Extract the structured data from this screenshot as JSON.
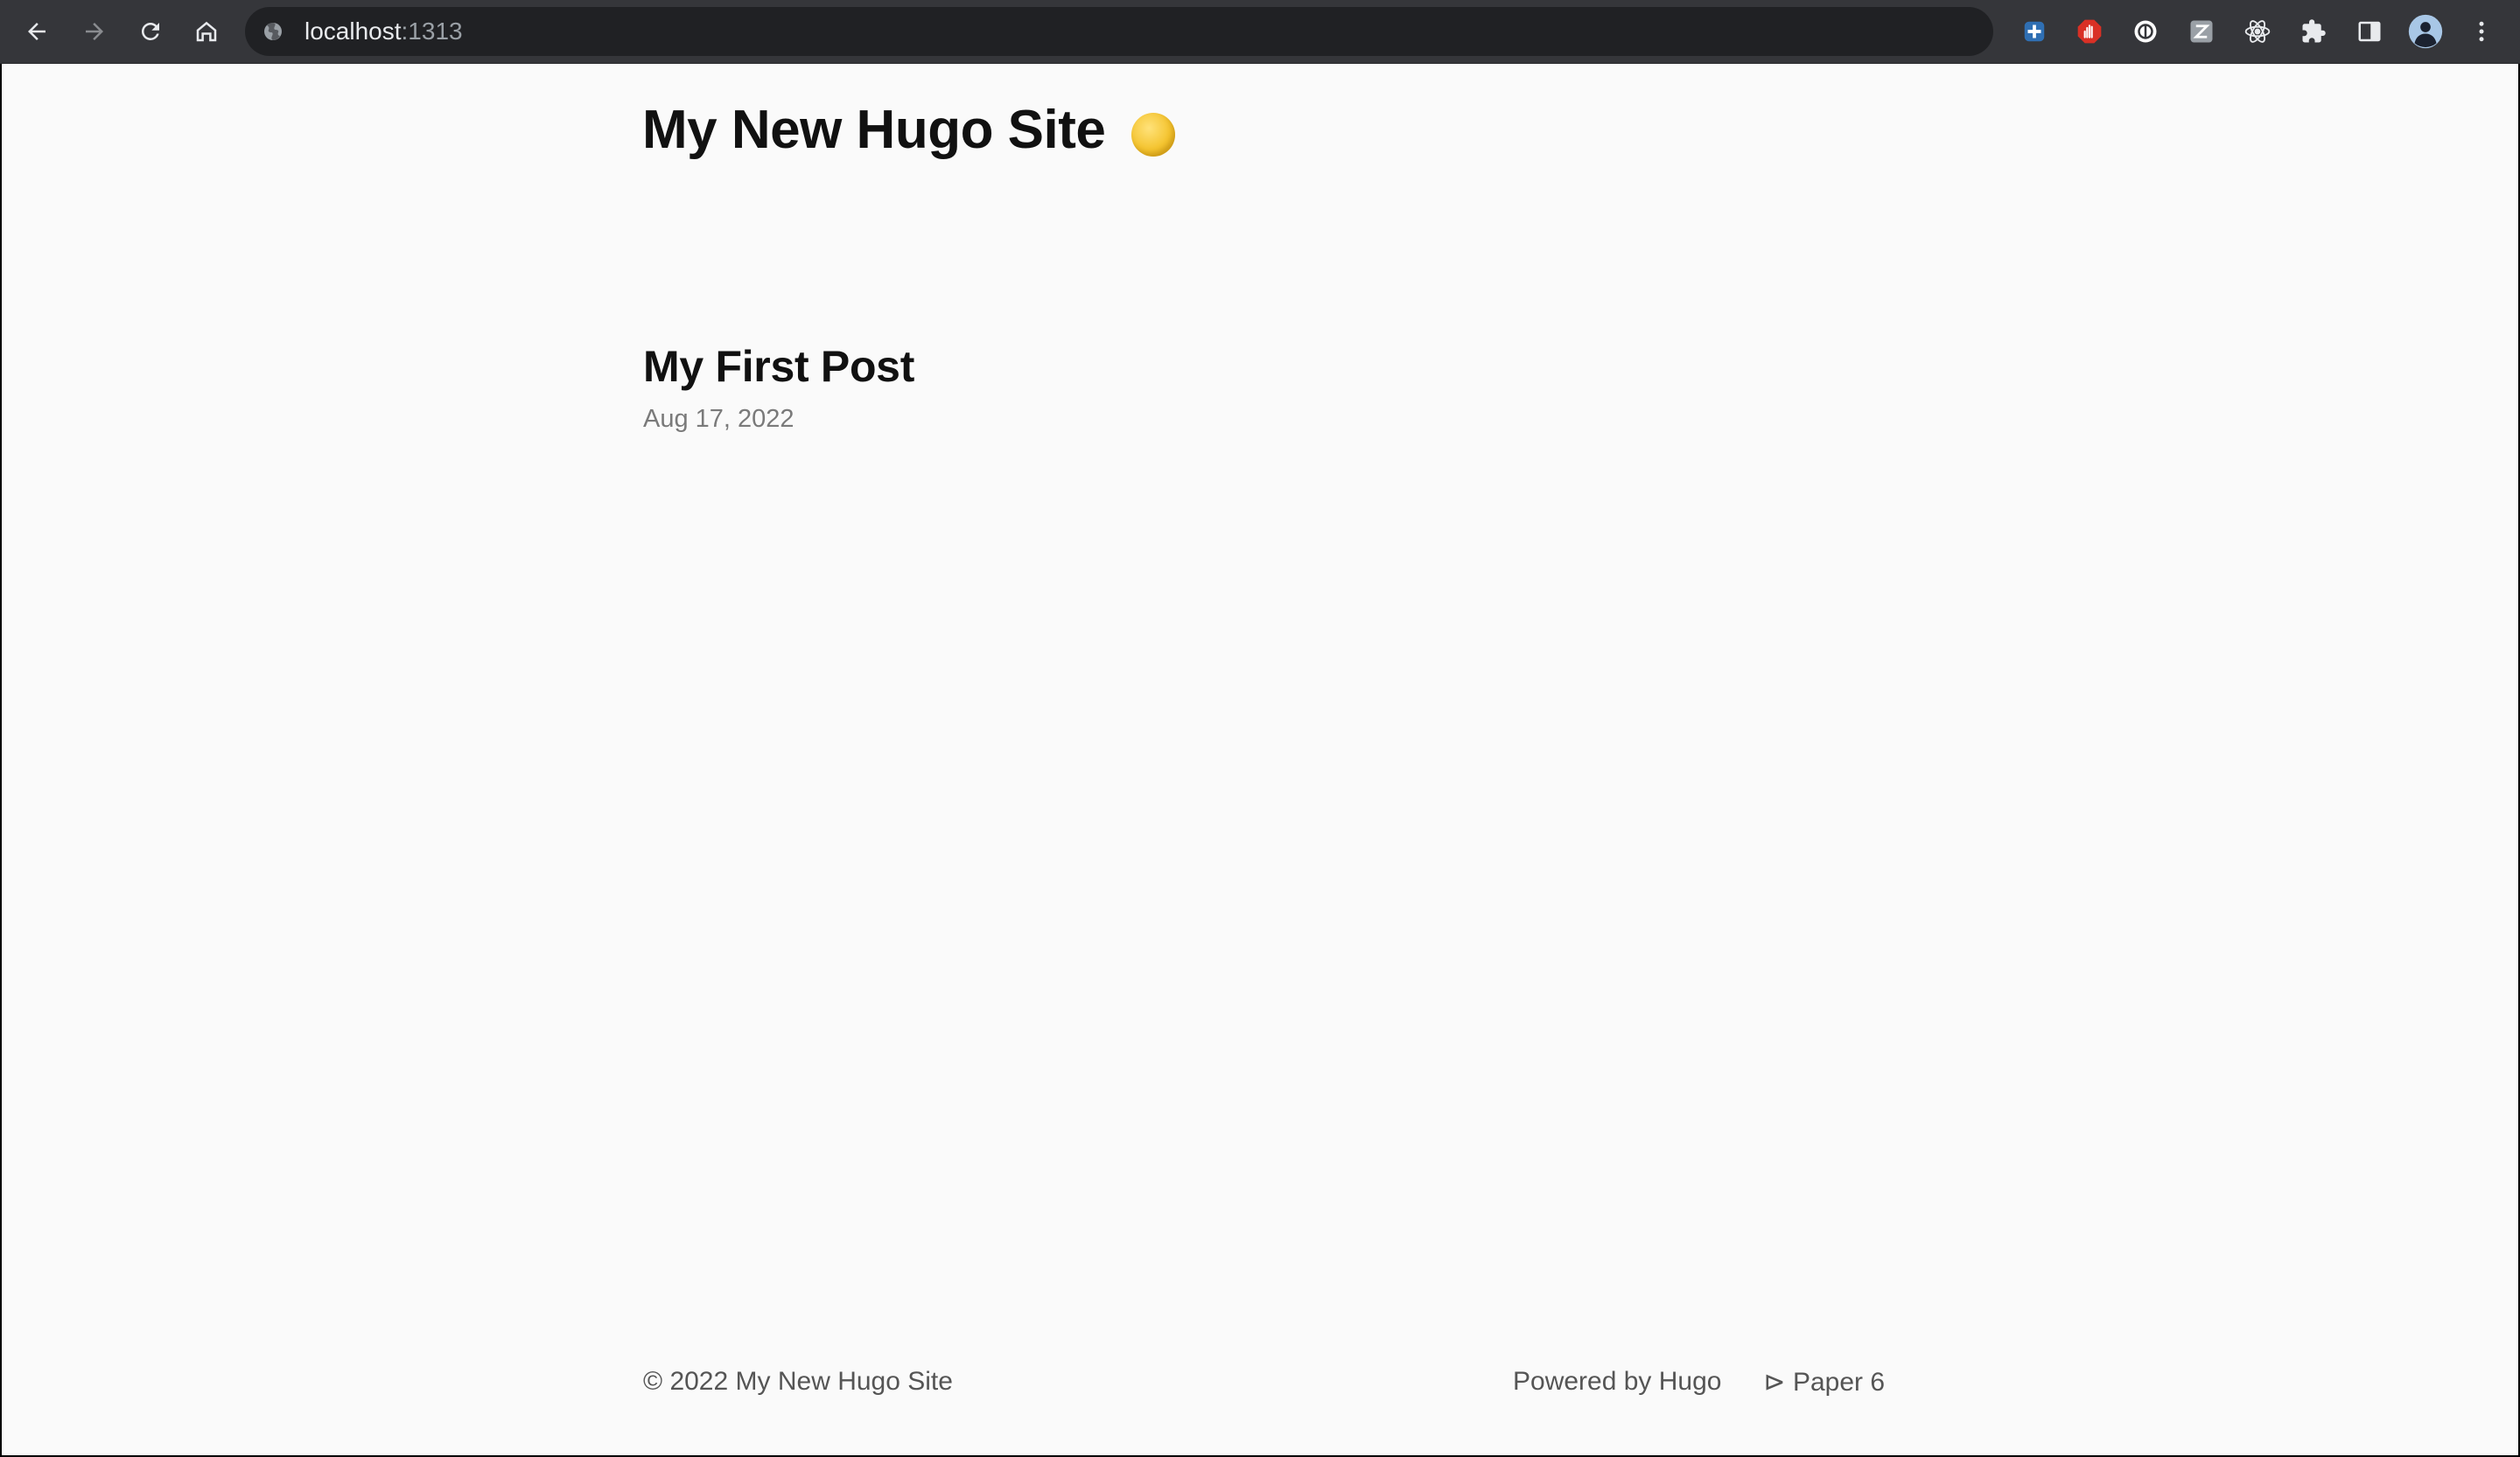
{
  "browser": {
    "url_host": "localhost",
    "url_port": ":1313",
    "icons": {
      "back": "back-arrow-icon",
      "forward": "forward-arrow-icon",
      "reload": "reload-icon",
      "home": "home-icon",
      "site_info": "globe-icon",
      "extensions": [
        "extension-puzzle-blue-icon",
        "adblock-hand-icon",
        "circle-extension-icon",
        "zotero-z-icon",
        "react-atom-icon",
        "extensions-puzzle-icon",
        "side-panel-icon",
        "profile-avatar-icon",
        "menu-kebab-icon"
      ]
    }
  },
  "site": {
    "title": "My New Hugo Site",
    "theme_toggle_icon": "sun-icon"
  },
  "posts": [
    {
      "title": "My First Post",
      "date": "Aug 17, 2022"
    }
  ],
  "footer": {
    "copyright": "© 2022 My New Hugo Site",
    "powered_by": "Powered by Hugo",
    "theme": "⊳ Paper 6"
  },
  "colors": {
    "page_background": "#fafafa",
    "text": "#111111",
    "muted_text": "#7a7a7a",
    "chrome_background": "#35363a",
    "omnibox_background": "#202124"
  }
}
